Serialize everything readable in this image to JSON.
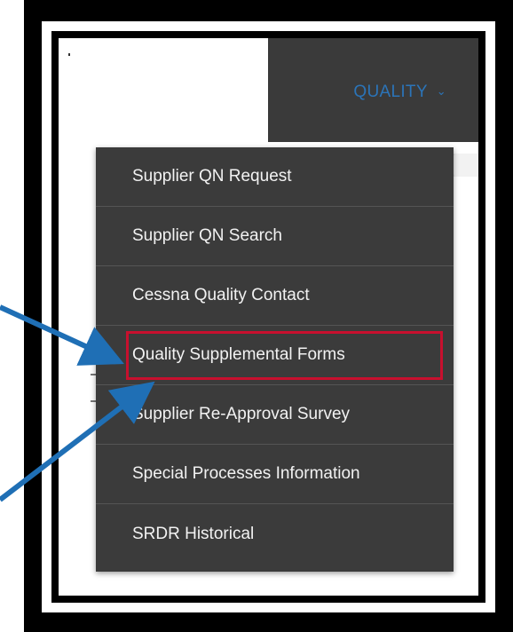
{
  "nav": {
    "label": "QUALITY",
    "chevron_icon": "chevron-down-icon",
    "accent_color": "#2b74b8"
  },
  "menu": {
    "items": [
      {
        "label": "Supplier QN Request"
      },
      {
        "label": "Supplier QN Search"
      },
      {
        "label": "Cessna Quality Contact"
      },
      {
        "label": "Quality Supplemental Forms",
        "highlighted": true
      },
      {
        "label": "Supplier Re-Approval Survey"
      },
      {
        "label": "Special Processes Information"
      },
      {
        "label": "SRDR Historical"
      }
    ],
    "background_color": "#3b3b3b",
    "highlight_color": "#c8102e"
  },
  "annotations": {
    "arrow_color": "#1f6fb5"
  }
}
